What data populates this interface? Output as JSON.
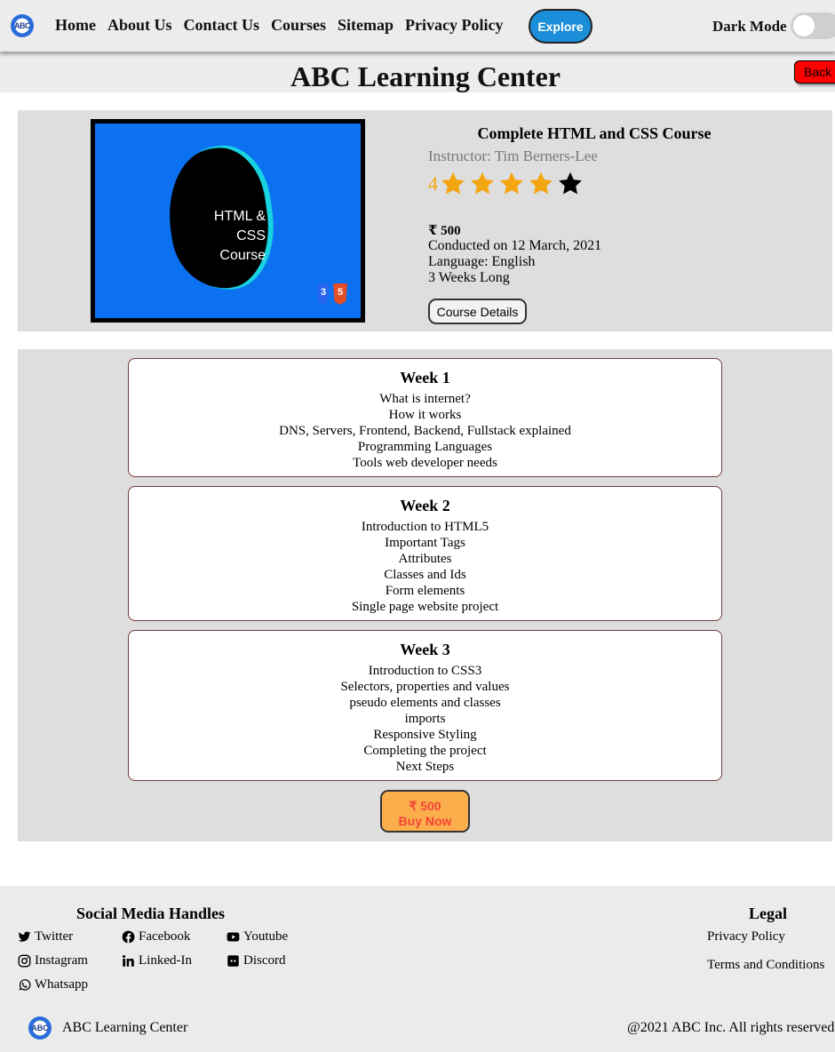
{
  "nav": {
    "logo_text": "ABC",
    "links": [
      "Home",
      "About Us",
      "Contact Us",
      "Courses",
      "Sitemap",
      "Privacy Policy"
    ],
    "explore_label": "Explore",
    "dark_mode_label": "Dark Mode",
    "dark_mode_on": false
  },
  "header": {
    "title": "ABC Learning Center",
    "back_label": "Back"
  },
  "course": {
    "thumbnail_text_line1": "HTML & CSS",
    "thumbnail_text_line2": "Course",
    "title": "Complete HTML and CSS Course",
    "instructor": "Instructor: Tim Berners-Lee",
    "rating": "4",
    "rating_stars_filled": 4,
    "rating_stars_total": 5,
    "price": "₹ 500",
    "date": "Conducted on 12 March, 2021",
    "language": "Language: English",
    "duration": "3 Weeks Long",
    "details_button": "Course Details"
  },
  "weeks": [
    {
      "title": "Week 1",
      "items": [
        "What is internet?",
        "How it works",
        "DNS, Servers, Frontend, Backend, Fullstack explained",
        "Programming Languages",
        "Tools web developer needs"
      ]
    },
    {
      "title": "Week 2",
      "items": [
        "Introduction to HTML5",
        "Important Tags",
        "Attributes",
        "Classes and Ids",
        "Form elements",
        "Single page website project"
      ]
    },
    {
      "title": "Week 3",
      "items": [
        "Introduction to CSS3",
        "Selectors, properties and values",
        "pseudo elements and classes",
        "imports",
        "Responsive Styling",
        "Completing the project",
        "Next Steps"
      ]
    }
  ],
  "buy": {
    "price": "₹ 500",
    "label": "Buy Now"
  },
  "footer": {
    "social_title": "Social Media Handles",
    "social": {
      "twitter": "Twitter",
      "facebook": "Facebook",
      "youtube": "Youtube",
      "instagram": "Instagram",
      "linkedin": "Linked-In",
      "discord": "Discord",
      "whatsapp": "Whatsapp"
    },
    "legal_title": "Legal",
    "legal_links": [
      "Privacy Policy",
      "Terms and Conditions"
    ],
    "brand": "ABC Learning Center",
    "logo_text": "ABC",
    "copyright": "@2021 ABC Inc. All rights reserved."
  },
  "colors": {
    "nav_bg": "#ececec",
    "explore_btn": "#1a8ed8",
    "back_btn": "#ff0000",
    "card_bg": "#dedede",
    "star_filled": "#f3a60f",
    "buy_btn": "#fbaf4c",
    "buy_text": "#f44336"
  }
}
